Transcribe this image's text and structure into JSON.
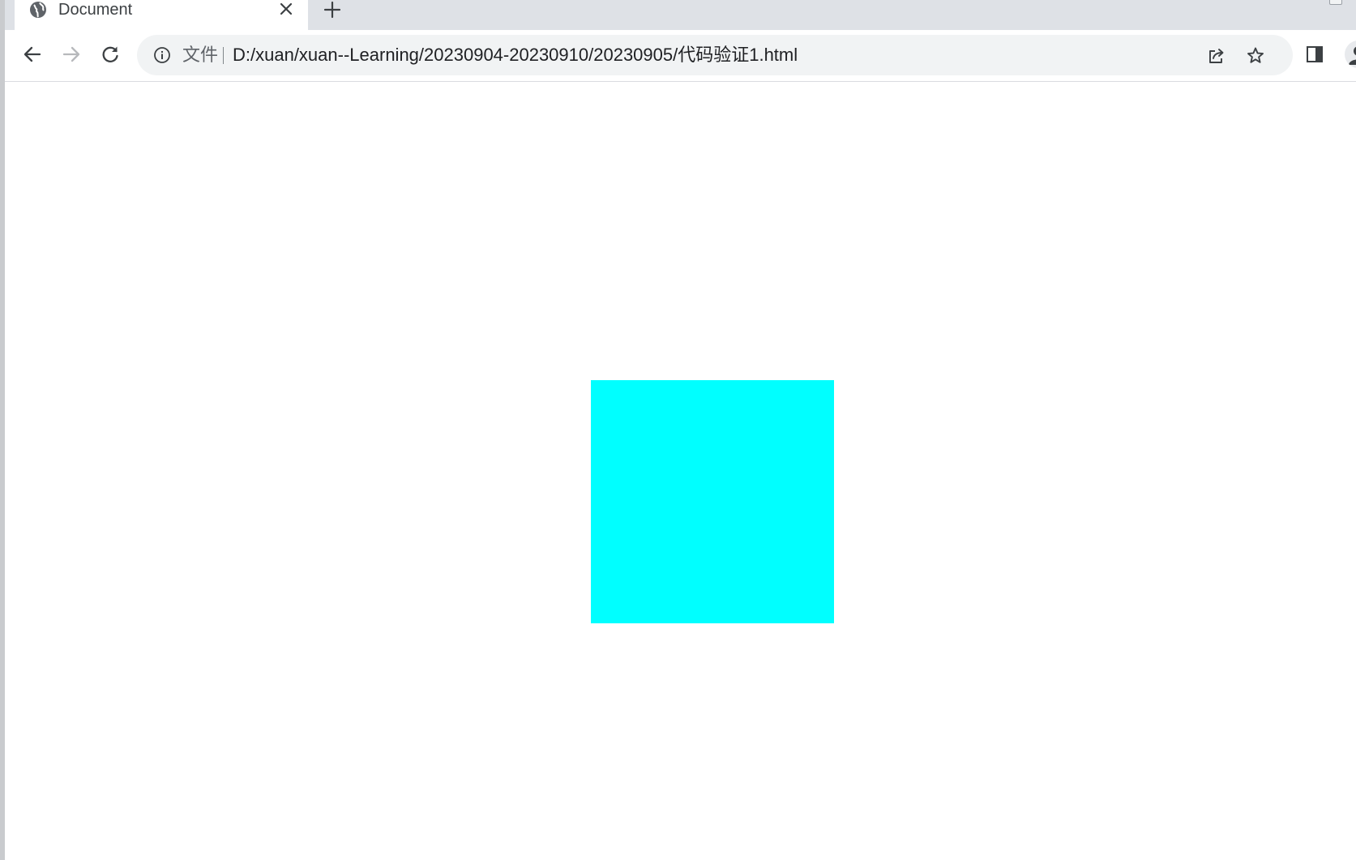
{
  "tab": {
    "title": "Document",
    "favicon": "globe-icon",
    "close_icon": "close-icon"
  },
  "tabstrip": {
    "new_tab_icon": "plus-icon"
  },
  "toolbar": {
    "back_icon": "arrow-left-icon",
    "forward_icon": "arrow-right-icon",
    "reload_icon": "reload-icon",
    "forward_enabled": false
  },
  "omnibox": {
    "info_icon": "info-icon",
    "scheme_label": "文件",
    "url": "D:/xuan/xuan--Learning/20230904-20230910/20230905/代码验证1.html",
    "share_icon": "share-icon",
    "bookmark_icon": "star-icon"
  },
  "extras": {
    "side_panel_icon": "side-panel-icon",
    "profile_icon": "person-icon"
  },
  "page": {
    "background": "#ffffff",
    "box_color": "#00ffff"
  },
  "colors": {
    "tabstrip_bg": "#dee1e6",
    "omnibox_bg": "#f1f3f4",
    "icon_gray": "#5f6368",
    "icon_disabled": "#b7b9bc"
  }
}
